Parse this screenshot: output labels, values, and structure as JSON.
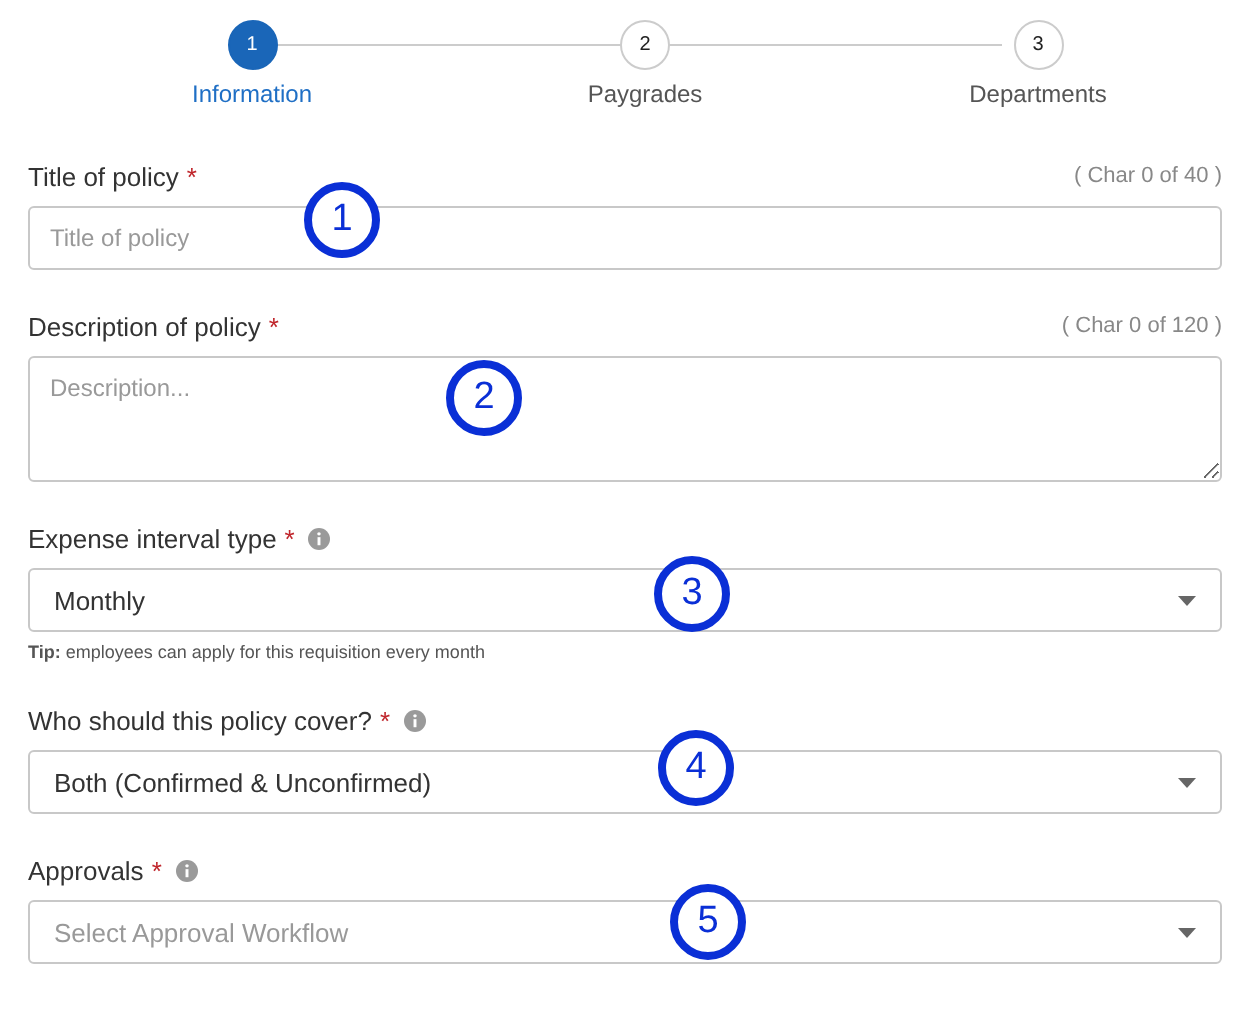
{
  "steps": [
    {
      "number": "1",
      "label": "Information",
      "selected": true
    },
    {
      "number": "2",
      "label": "Paygrades",
      "selected": false
    },
    {
      "number": "3",
      "label": "Departments",
      "selected": false
    }
  ],
  "fields": [
    {
      "kind": "text",
      "label": "Title of policy",
      "required_mark": "*",
      "counter": "( Char 0 of 40 )",
      "placeholder": "Title of policy",
      "callout": "1"
    },
    {
      "kind": "textarea",
      "label": "Description of policy",
      "required_mark": "*",
      "counter": "( Char 0 of 120 )",
      "placeholder": "Description...",
      "callout": "2"
    },
    {
      "kind": "select",
      "label": "Expense interval type",
      "required_mark": "*",
      "info": true,
      "value": "Monthly",
      "tip": "**Tip:** employees can apply for this requisition every month",
      "callout": "3"
    },
    {
      "kind": "select",
      "label": "Who should this policy cover?",
      "required_mark": "*",
      "info": true,
      "value": "Both (Confirmed & Unconfirmed)",
      "callout": "4"
    },
    {
      "kind": "select",
      "label": "Approvals",
      "required_mark": "*",
      "info": true,
      "placeholder": "Select Approval Workflow",
      "callout": "5"
    }
  ]
}
